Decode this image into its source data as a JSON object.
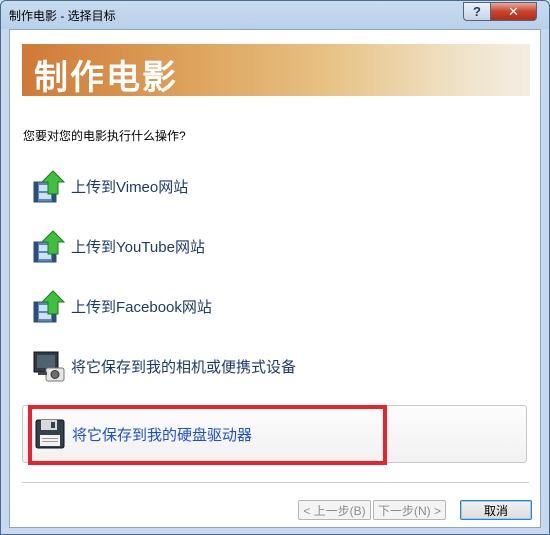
{
  "window": {
    "title": "制作电影 - 选择目标",
    "help_label": "?",
    "close_label": "✕"
  },
  "banner": {
    "title": "制作电影"
  },
  "prompt": "您要对您的电影执行什么操作?",
  "options": [
    {
      "label": "上传到Vimeo网站",
      "icon": "upload-film-icon"
    },
    {
      "label": "上传到YouTube网站",
      "icon": "upload-film-icon"
    },
    {
      "label": "上传到Facebook网站",
      "icon": "upload-film-icon"
    },
    {
      "label": "将它保存到我的相机或便携式设备",
      "icon": "camera-device-icon"
    },
    {
      "label": "将它保存到我的硬盘驱动器",
      "icon": "floppy-disk-icon"
    }
  ],
  "buttons": {
    "back": "< 上一步(B)",
    "next": "下一步(N) >",
    "cancel": "取消"
  },
  "colors": {
    "highlight": "#e8232c",
    "link": "#1c3a6b",
    "selected_link": "#1b4fd8"
  }
}
